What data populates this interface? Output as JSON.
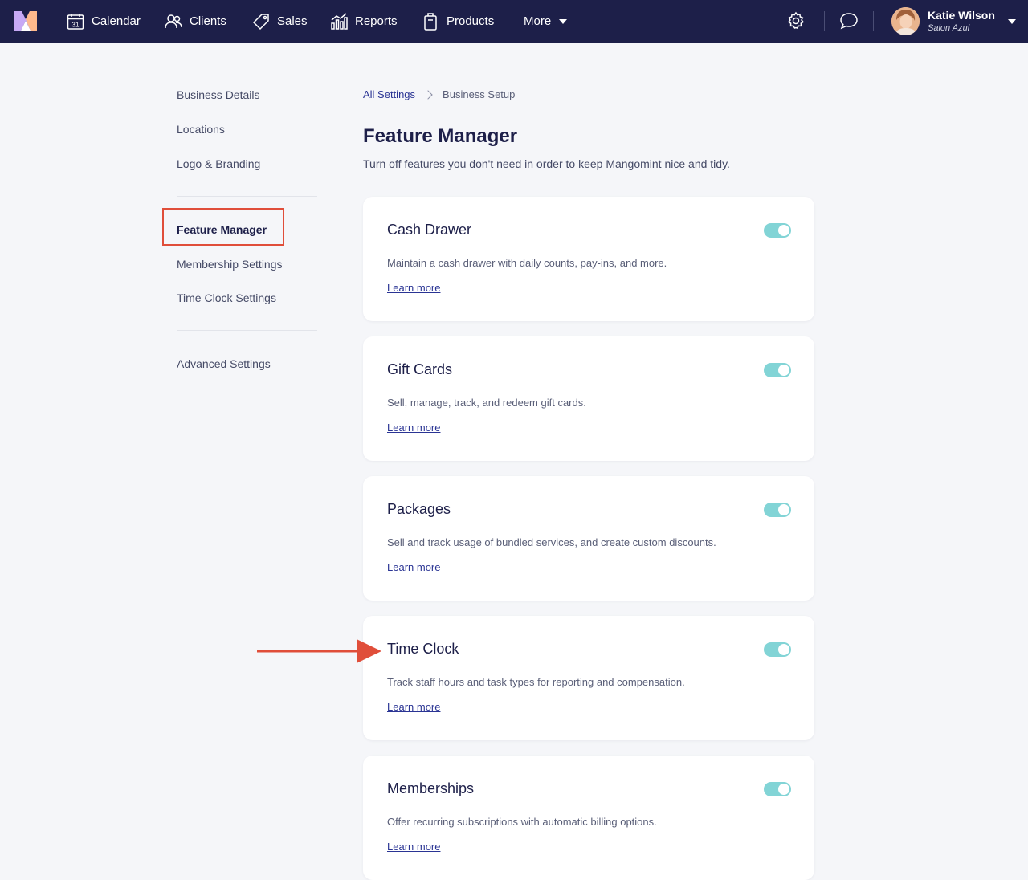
{
  "colors": {
    "nav_bg": "#1d1f49",
    "page_bg": "#f5f6f9",
    "link": "#2a3494",
    "toggle_on": "#82d4d6",
    "highlight": "#e04e3a"
  },
  "nav": {
    "logo_icon": "mangomint-logo",
    "items": [
      {
        "label": "Calendar",
        "icon": "calendar-icon"
      },
      {
        "label": "Clients",
        "icon": "clients-icon"
      },
      {
        "label": "Sales",
        "icon": "tag-icon"
      },
      {
        "label": "Reports",
        "icon": "chart-icon"
      },
      {
        "label": "Products",
        "icon": "box-icon"
      },
      {
        "label": "More",
        "icon": "chevron-down-icon"
      }
    ],
    "settings_icon": "gear-icon",
    "messages_icon": "chat-icon",
    "user": {
      "name": "Katie Wilson",
      "business": "Salon Azul"
    }
  },
  "sidebar": {
    "group1": [
      "Business Details",
      "Locations",
      "Logo & Branding"
    ],
    "group2": [
      "Feature Manager",
      "Membership Settings",
      "Time Clock Settings"
    ],
    "group3": [
      "Advanced Settings"
    ],
    "active": "Feature Manager"
  },
  "breadcrumb": {
    "parent": "All Settings",
    "current": "Business Setup"
  },
  "page": {
    "title": "Feature Manager",
    "subtitle": "Turn off features you don't need in order to keep Mangomint nice and tidy."
  },
  "features": [
    {
      "name": "Cash Drawer",
      "description": "Maintain a cash drawer with daily counts, pay-ins, and more.",
      "link": "Learn more",
      "enabled": true
    },
    {
      "name": "Gift Cards",
      "description": "Sell, manage, track, and redeem gift cards.",
      "link": "Learn more",
      "enabled": true
    },
    {
      "name": "Packages",
      "description": "Sell and track usage of bundled services, and create custom discounts.",
      "link": "Learn more",
      "enabled": true
    },
    {
      "name": "Time Clock",
      "description": "Track staff hours and task types for reporting and compensation.",
      "link": "Learn more",
      "enabled": true
    },
    {
      "name": "Memberships",
      "description": "Offer recurring subscriptions with automatic billing options.",
      "link": "Learn more",
      "enabled": true
    }
  ]
}
